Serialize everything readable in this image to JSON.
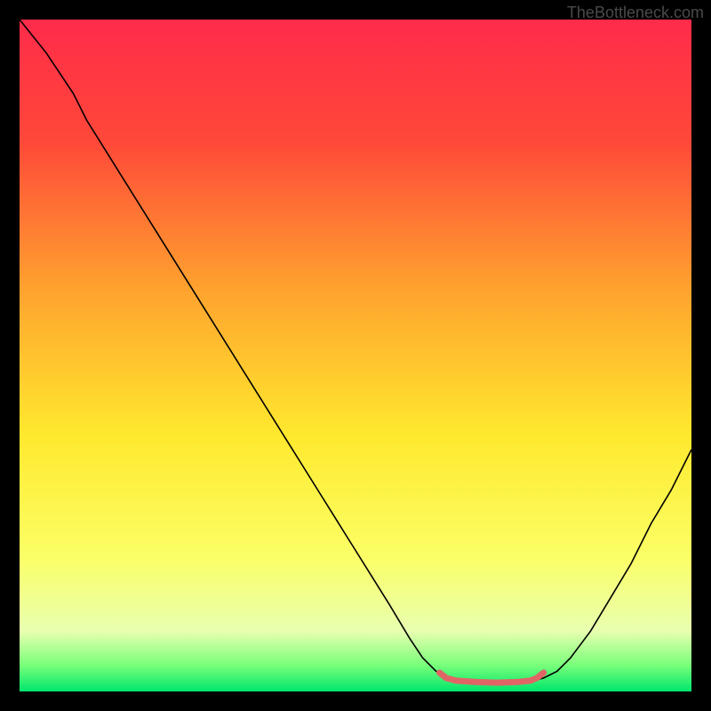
{
  "watermark": "TheBottleneck.com",
  "chart_data": {
    "type": "line",
    "title": "",
    "xlabel": "",
    "ylabel": "",
    "xlim": [
      0,
      100
    ],
    "ylim": [
      0,
      100
    ],
    "background_gradient": {
      "type": "vertical",
      "stops": [
        {
          "offset": 0,
          "color": "#ff2b4a"
        },
        {
          "offset": 18,
          "color": "#ff4839"
        },
        {
          "offset": 40,
          "color": "#ffa22e"
        },
        {
          "offset": 62,
          "color": "#ffe92e"
        },
        {
          "offset": 80,
          "color": "#fbff66"
        },
        {
          "offset": 91,
          "color": "#e8ffb0"
        },
        {
          "offset": 96,
          "color": "#7bff7b"
        },
        {
          "offset": 100,
          "color": "#00e66b"
        }
      ]
    },
    "series": [
      {
        "name": "bottleneck-curve",
        "color": "#000000",
        "width": 1.6,
        "points": [
          {
            "x": 0,
            "y": 100
          },
          {
            "x": 4,
            "y": 95
          },
          {
            "x": 8,
            "y": 89
          },
          {
            "x": 10,
            "y": 85
          },
          {
            "x": 15,
            "y": 77
          },
          {
            "x": 20,
            "y": 69
          },
          {
            "x": 25,
            "y": 61
          },
          {
            "x": 30,
            "y": 53
          },
          {
            "x": 35,
            "y": 45
          },
          {
            "x": 40,
            "y": 37
          },
          {
            "x": 45,
            "y": 29
          },
          {
            "x": 50,
            "y": 21
          },
          {
            "x": 55,
            "y": 13
          },
          {
            "x": 58,
            "y": 8
          },
          {
            "x": 60,
            "y": 5
          },
          {
            "x": 62,
            "y": 3
          },
          {
            "x": 64,
            "y": 2
          },
          {
            "x": 66,
            "y": 1.5
          },
          {
            "x": 68,
            "y": 1.3
          },
          {
            "x": 70,
            "y": 1.2
          },
          {
            "x": 72,
            "y": 1.2
          },
          {
            "x": 74,
            "y": 1.3
          },
          {
            "x": 76,
            "y": 1.5
          },
          {
            "x": 78,
            "y": 2
          },
          {
            "x": 80,
            "y": 3
          },
          {
            "x": 82,
            "y": 5
          },
          {
            "x": 85,
            "y": 9
          },
          {
            "x": 88,
            "y": 14
          },
          {
            "x": 91,
            "y": 19
          },
          {
            "x": 94,
            "y": 25
          },
          {
            "x": 97,
            "y": 30
          },
          {
            "x": 100,
            "y": 36
          }
        ]
      },
      {
        "name": "optimal-range-marker",
        "color": "#e06666",
        "width": 7,
        "points": [
          {
            "x": 62.5,
            "y": 2.8
          },
          {
            "x": 63.5,
            "y": 2.0
          },
          {
            "x": 65,
            "y": 1.6
          },
          {
            "x": 68,
            "y": 1.4
          },
          {
            "x": 71,
            "y": 1.3
          },
          {
            "x": 74,
            "y": 1.4
          },
          {
            "x": 76,
            "y": 1.6
          },
          {
            "x": 77,
            "y": 2.0
          },
          {
            "x": 78,
            "y": 2.8
          }
        ]
      }
    ]
  }
}
